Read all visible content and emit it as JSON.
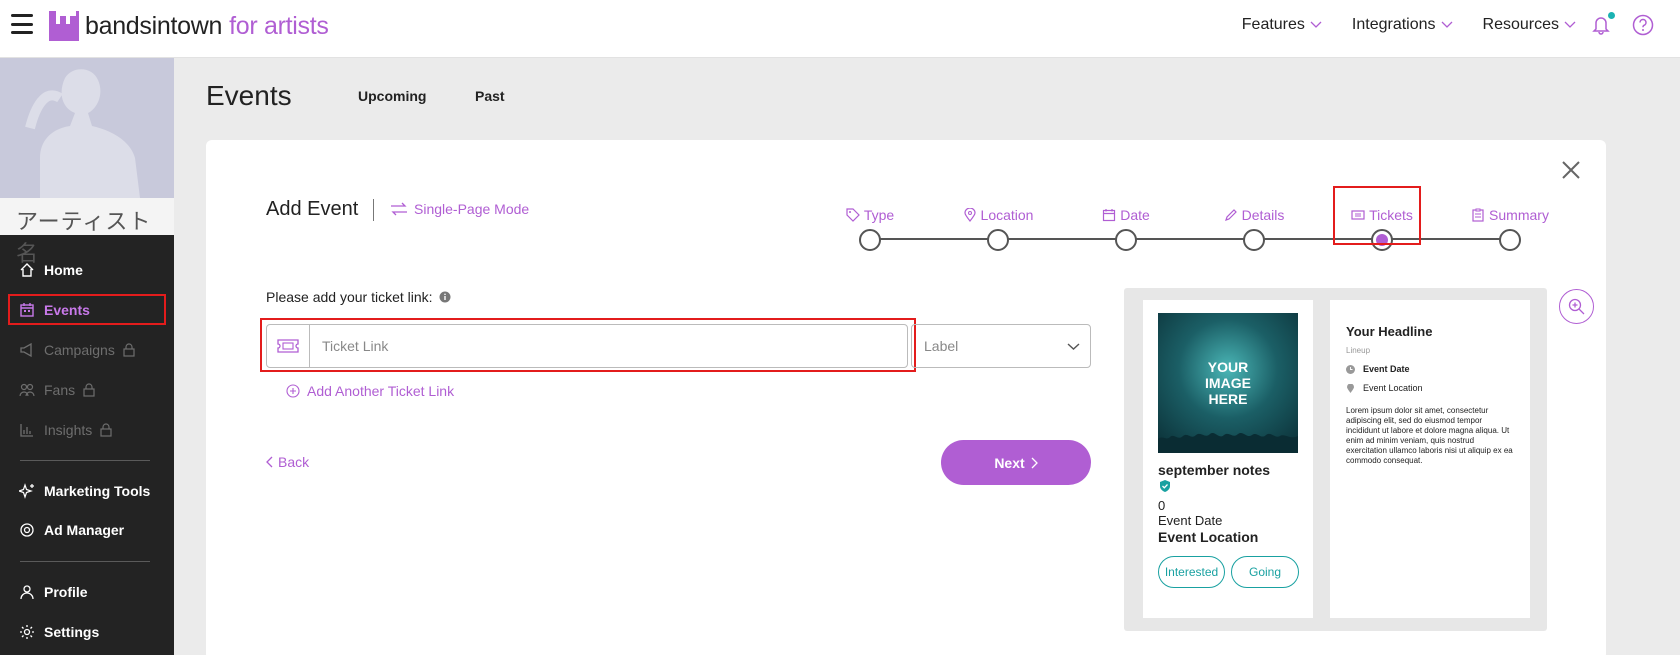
{
  "topbar": {
    "logo_main": "bandsintown",
    "logo_sub": "for artists",
    "nav": [
      {
        "label": "Features"
      },
      {
        "label": "Integrations"
      },
      {
        "label": "Resources"
      }
    ],
    "icons": [
      "menu-icon",
      "bell-icon",
      "help-icon"
    ]
  },
  "sidebar": {
    "artist_name": "アーティスト名",
    "items": [
      {
        "label": "Home",
        "icon": "home-icon",
        "state": "normal"
      },
      {
        "label": "Events",
        "icon": "calendar-icon",
        "state": "active"
      },
      {
        "label": "Campaigns",
        "icon": "megaphone-icon",
        "state": "locked"
      },
      {
        "label": "Fans",
        "icon": "users-icon",
        "state": "locked"
      },
      {
        "label": "Insights",
        "icon": "chart-icon",
        "state": "locked"
      },
      {
        "label": "Marketing Tools",
        "icon": "sparkles-icon",
        "state": "normal"
      },
      {
        "label": "Ad Manager",
        "icon": "target-icon",
        "state": "normal"
      },
      {
        "label": "Profile",
        "icon": "user-icon",
        "state": "normal"
      },
      {
        "label": "Settings",
        "icon": "gear-icon",
        "state": "normal"
      }
    ]
  },
  "page": {
    "title": "Events",
    "tabs": [
      {
        "label": "Upcoming"
      },
      {
        "label": "Past"
      }
    ]
  },
  "form": {
    "title": "Add Event",
    "single_page_mode": "Single-Page Mode",
    "steps": [
      {
        "label": "Type",
        "icon": "tag-icon"
      },
      {
        "label": "Location",
        "icon": "pin-icon"
      },
      {
        "label": "Date",
        "icon": "calendar-icon"
      },
      {
        "label": "Details",
        "icon": "pencil-icon"
      },
      {
        "label": "Tickets",
        "icon": "ticket-icon"
      },
      {
        "label": "Summary",
        "icon": "clipboard-icon"
      }
    ],
    "current_step": "Tickets",
    "ticket_prompt": "Please add your ticket link:",
    "ticket_placeholder": "Ticket Link",
    "ticket_value": "",
    "label_select": "Label",
    "add_another": "Add Another Ticket Link",
    "back": "Back",
    "next": "Next"
  },
  "preview": {
    "image_text": "YOUR IMAGE HERE",
    "artist": "september notes",
    "count": "0",
    "event_date": "Event Date",
    "event_location": "Event Location",
    "btn_interested": "Interested",
    "btn_going": "Going",
    "headline": "Your Headline",
    "lineup": "Lineup",
    "detail_date": "Event Date",
    "detail_location": "Event Location",
    "lorem": "Lorem ipsum dolor sit amet, consectetur adipiscing elit, sed do eiusmod tempor incididunt ut labore et dolore magna aliqua. Ut enim ad minim veniam, quis nostrud exercitation ullamco laboris nisi ut aliquip ex ea commodo consequat."
  },
  "colors": {
    "accent": "#b05ed3",
    "teal": "#19a1a1",
    "sidebar_bg": "#232323",
    "highlight": "#e31c1c"
  }
}
